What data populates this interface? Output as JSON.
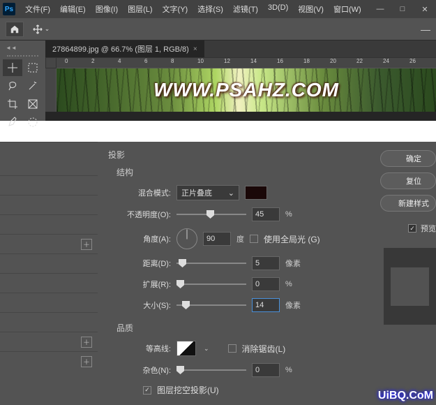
{
  "app_logo": "Ps",
  "menu": [
    "文件(F)",
    "编辑(E)",
    "图像(I)",
    "图层(L)",
    "文字(Y)",
    "选择(S)",
    "滤镜(T)",
    "3D(D)",
    "视图(V)",
    "窗口(W)"
  ],
  "win_controls": {
    "minimize": "—",
    "maximize": "□",
    "close": "✕"
  },
  "document_tab": "27864899.jpg @ 66.7% (图层 1, RGB/8)",
  "tab_close": "×",
  "ruler_ticks": [
    "0",
    "2",
    "4",
    "6",
    "8",
    "10",
    "12",
    "14",
    "16",
    "18",
    "20",
    "22",
    "24",
    "26"
  ],
  "canvas_text": "WWW.PSAHZ.COM",
  "dialog": {
    "effect_title": "投影",
    "structure_title": "结构",
    "blend_mode_label": "混合模式:",
    "blend_mode_value": "正片叠底",
    "opacity_label": "不透明度(O):",
    "opacity_value": "45",
    "opacity_unit": "%",
    "angle_label": "角度(A):",
    "angle_value": "90",
    "angle_unit": "度",
    "global_light_label": "使用全局光 (G)",
    "distance_label": "距离(D):",
    "distance_value": "5",
    "distance_unit": "像素",
    "spread_label": "扩展(R):",
    "spread_value": "0",
    "spread_unit": "%",
    "size_label": "大小(S):",
    "size_value": "14",
    "size_unit": "像素",
    "quality_title": "品质",
    "contour_label": "等高线:",
    "antialias_label": "消除锯齿(L)",
    "noise_label": "杂色(N):",
    "noise_value": "0",
    "noise_unit": "%",
    "knockout_label": "图层挖空投影(U)"
  },
  "buttons": {
    "ok": "确定",
    "reset": "复位",
    "new_style": "新建样式",
    "preview": "预览"
  },
  "watermark": "UiBQ.CoM",
  "plus_icon": "＋",
  "check_icon": "✓",
  "dropdown_icon": "⌄"
}
